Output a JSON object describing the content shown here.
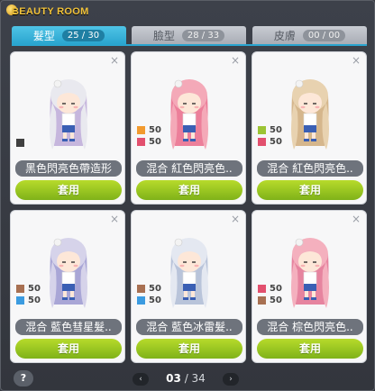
{
  "window": {
    "title": "BEAUTY ROOM"
  },
  "tabs": [
    {
      "label": "髮型",
      "count": "25 / 30",
      "active": true
    },
    {
      "label": "臉型",
      "count": "28 / 33",
      "active": false
    },
    {
      "label": "皮膚",
      "count": "00 / 00",
      "active": false
    }
  ],
  "cards": [
    {
      "name": "黑色閃亮色帶造形",
      "apply": "套用",
      "hair": "#e9e9ef",
      "hair2": "#c6b6dd",
      "swatches": [
        {
          "color": "#404040",
          "num": ""
        }
      ]
    },
    {
      "name": "混合 紅色閃亮色..",
      "apply": "套用",
      "hair": "#f4a9b8",
      "hair2": "#ec7f9a",
      "swatches": [
        {
          "color": "#f29a2e",
          "num": "50"
        },
        {
          "color": "#e2506e",
          "num": "50"
        }
      ]
    },
    {
      "name": "混合 紅色閃亮色..",
      "apply": "套用",
      "hair": "#e8d2b0",
      "hair2": "#d5b68c",
      "swatches": [
        {
          "color": "#9cc434",
          "num": "50"
        },
        {
          "color": "#e2506e",
          "num": "50"
        }
      ]
    },
    {
      "name": "混合 藍色彗星髮..",
      "apply": "套用",
      "hair": "#d6d3ea",
      "hair2": "#a9a6d6",
      "swatches": [
        {
          "color": "#a87052",
          "num": "50"
        },
        {
          "color": "#3b9be0",
          "num": "50"
        }
      ]
    },
    {
      "name": "混合 藍色冰雷髮..",
      "apply": "套用",
      "hair": "#e4e8f1",
      "hair2": "#b9c4da",
      "swatches": [
        {
          "color": "#a87052",
          "num": "50"
        },
        {
          "color": "#3b9be0",
          "num": "50"
        }
      ]
    },
    {
      "name": "混合 棕色閃亮色..",
      "apply": "套用",
      "hair": "#f4b0be",
      "hair2": "#e6849f",
      "swatches": [
        {
          "color": "#e2506e",
          "num": "50"
        },
        {
          "color": "#a87052",
          "num": "50"
        }
      ]
    }
  ],
  "footer": {
    "help": "?",
    "page_current": "03",
    "page_sep": " / ",
    "page_total": "34",
    "prev": "‹",
    "next": "›"
  }
}
